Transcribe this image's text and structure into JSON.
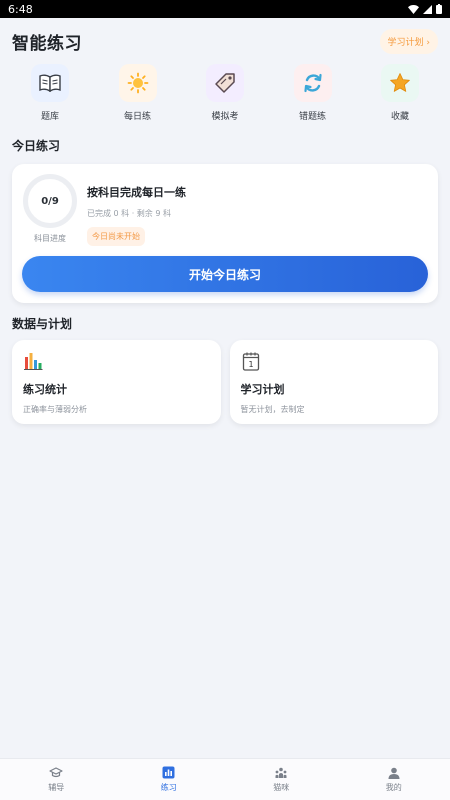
{
  "status_bar": {
    "time": "6:48"
  },
  "header": {
    "title": "智能练习",
    "plan_chip": "学习计划 ›"
  },
  "quick_nav": [
    {
      "label": "题库",
      "icon": "book-icon",
      "bg": "#eaf1ff"
    },
    {
      "label": "每日练",
      "icon": "sun-icon",
      "bg": "#fff5e9"
    },
    {
      "label": "模拟考",
      "icon": "tag-icon",
      "bg": "#f3edff"
    },
    {
      "label": "错题练",
      "icon": "refresh-icon",
      "bg": "#fdeff0"
    },
    {
      "label": "收藏",
      "icon": "star-icon",
      "bg": "#eaf8f3"
    }
  ],
  "today": {
    "section_title": "今日练习",
    "progress": "0/9",
    "progress_caption": "科目进度",
    "heading": "按科目完成每日一练",
    "sub": "已完成 0 科 · 剩余 9 科",
    "status": "今日尚未开始",
    "start_label": "开始今日练习"
  },
  "stats": {
    "section_title": "数据与计划",
    "cards": [
      {
        "title": "练习统计",
        "desc": "正确率与薄弱分析",
        "icon": "bar-chart-icon"
      },
      {
        "title": "学习计划",
        "desc": "暂无计划，去制定",
        "icon": "calendar-icon"
      }
    ]
  },
  "bottom_nav": [
    {
      "label": "辅导",
      "icon": "graduation-cap-icon",
      "active": false
    },
    {
      "label": "练习",
      "icon": "chart-box-icon",
      "active": true
    },
    {
      "label": "猫咪",
      "icon": "people-icon",
      "active": false
    },
    {
      "label": "我的",
      "icon": "person-icon",
      "active": false
    }
  ],
  "colors": {
    "accent": "#2f6fe0",
    "warning": "#f39a48"
  }
}
